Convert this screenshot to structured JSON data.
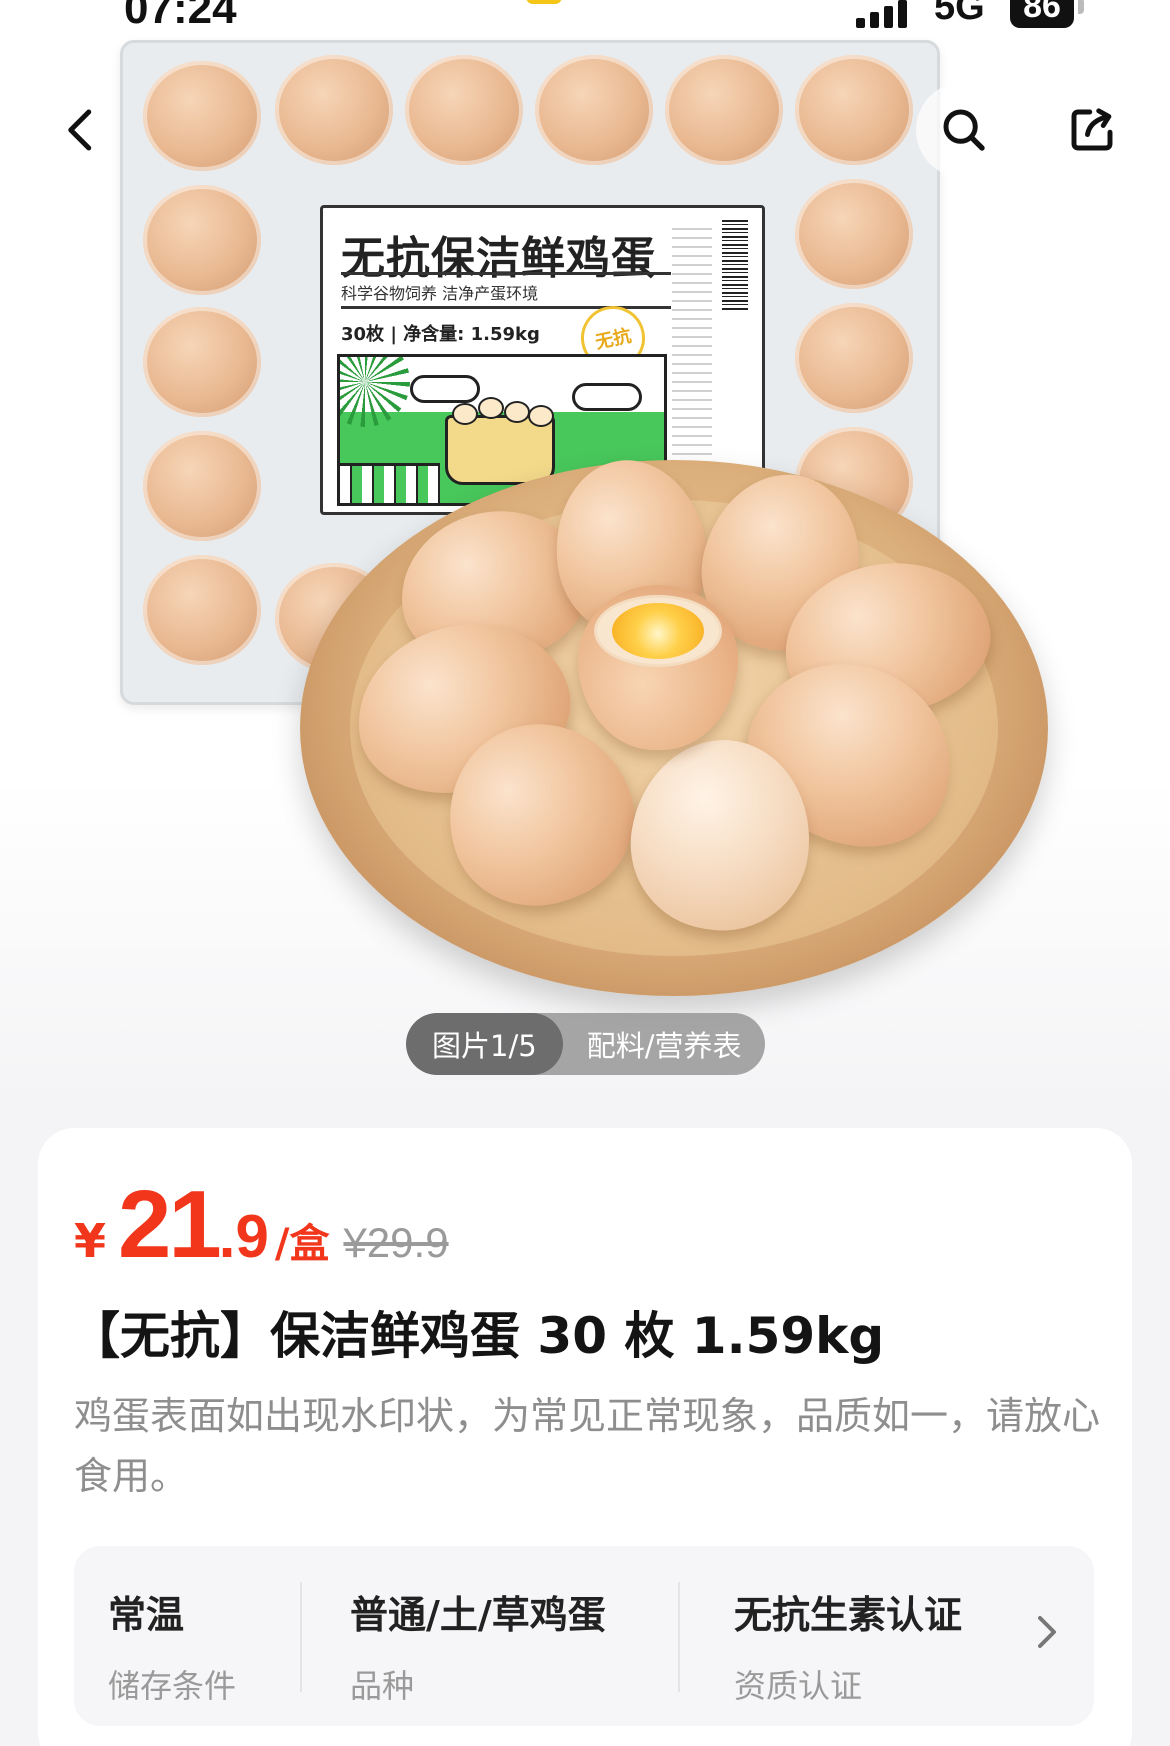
{
  "status_bar": {
    "time": "07:24",
    "network": "5G",
    "battery": "86"
  },
  "product_image": {
    "label_title": "无抗保洁鲜鸡蛋",
    "label_subtitle": "科学谷物饲养  洁净产蛋环境",
    "label_spec": "30枚 | 净含量: 1.59kg",
    "label_badge": "无抗"
  },
  "nav": {
    "back_icon": "chevron-left-icon",
    "search_icon": "search-icon",
    "share_icon": "share-icon"
  },
  "pager": {
    "tabs": [
      {
        "label": "图片1/5",
        "active": true
      },
      {
        "label": "配料/营养表",
        "active": false
      }
    ]
  },
  "price": {
    "symbol": "¥",
    "integer": "21",
    "decimal": ".9",
    "unit": "/盒",
    "original": "¥29.9",
    "color": "#f2361c"
  },
  "product": {
    "title": "【无抗】保洁鲜鸡蛋 30 枚 1.59kg",
    "description": "鸡蛋表面如出现水印状，为常见正常现象，品质如一，请放心食用。"
  },
  "attributes": [
    {
      "value": "常温",
      "key": "储存条件"
    },
    {
      "value": "普通/土/草鸡蛋",
      "key": "品种"
    },
    {
      "value": "无抗生素认证",
      "key": "资质认证"
    }
  ]
}
